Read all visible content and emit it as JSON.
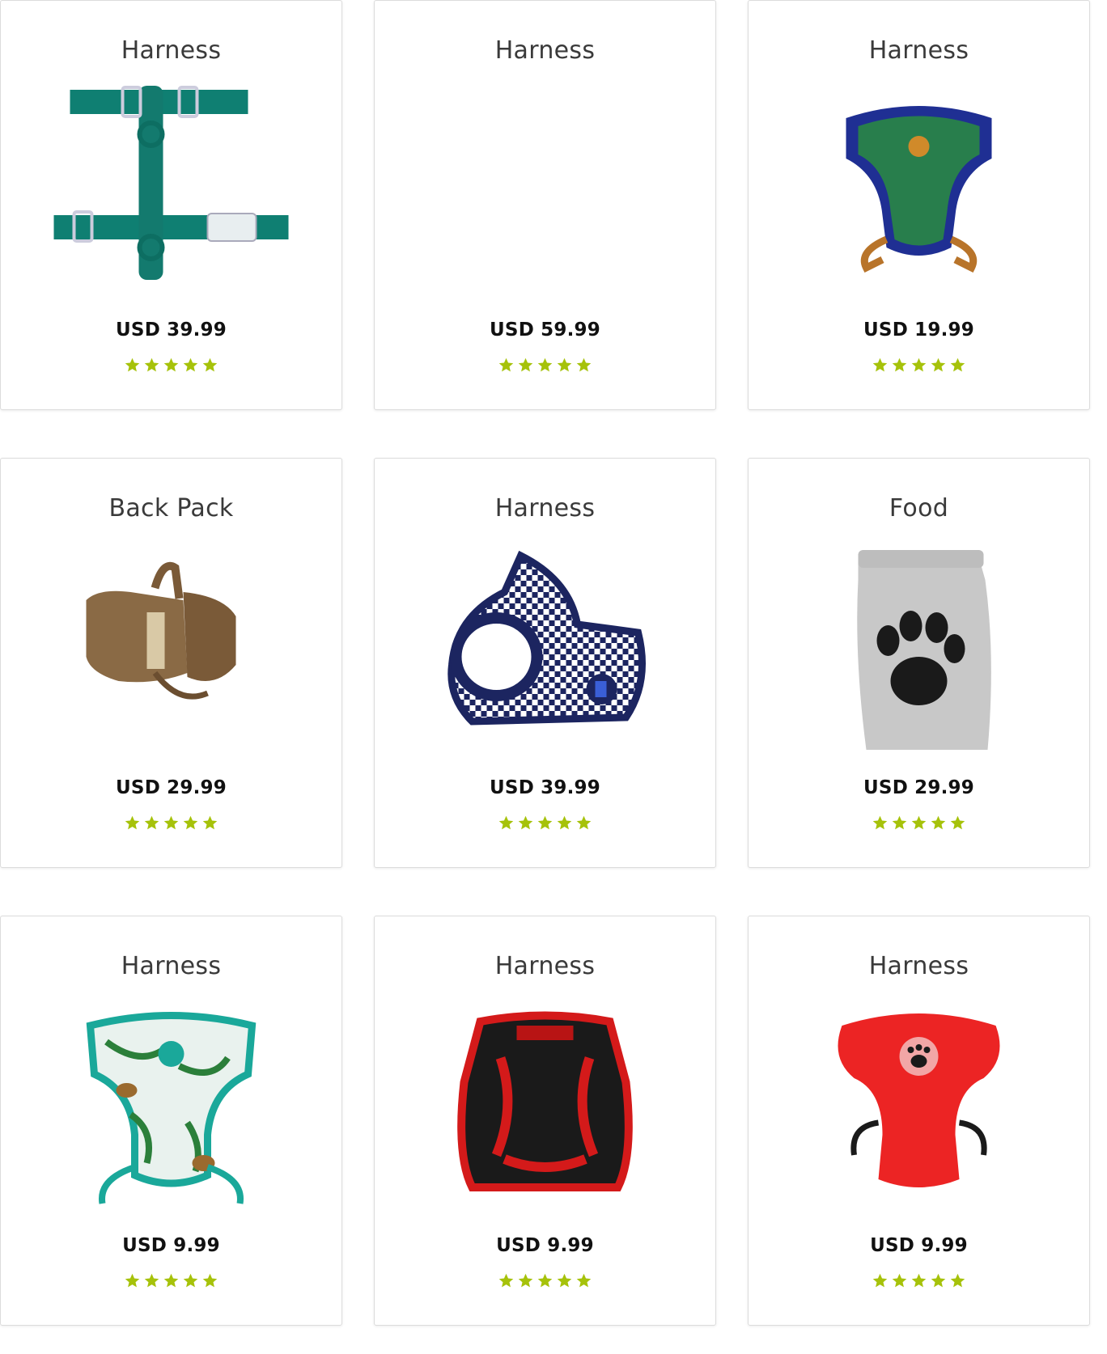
{
  "products": [
    {
      "title": "Harness",
      "price": "USD 39.99",
      "image": "teal-strap-harness",
      "rating": 5
    },
    {
      "title": "Harness",
      "price": "USD 59.99",
      "image": "",
      "rating": 5
    },
    {
      "title": "Harness",
      "price": "USD 19.99",
      "image": "green-cactus-harness",
      "rating": 5
    },
    {
      "title": "Back Pack",
      "price": "USD 29.99",
      "image": "brown-dog-backpack",
      "rating": 5
    },
    {
      "title": "Harness",
      "price": "USD 39.99",
      "image": "navy-checkered-vest-harness",
      "rating": 5
    },
    {
      "title": "Food",
      "price": "USD 29.99",
      "image": "paw-print-food-bag",
      "rating": 5
    },
    {
      "title": "Harness",
      "price": "USD 9.99",
      "image": "tropical-leaf-harness",
      "rating": 5
    },
    {
      "title": "Harness",
      "price": "USD 9.99",
      "image": "red-black-mesh-harness",
      "rating": 5
    },
    {
      "title": "Harness",
      "price": "USD 9.99",
      "image": "red-paw-mesh-harness",
      "rating": 5
    }
  ],
  "colors": {
    "star": "#a6c20a",
    "price": "#111111",
    "title": "#3a3a3a",
    "card_border": "#dcdcdc"
  }
}
